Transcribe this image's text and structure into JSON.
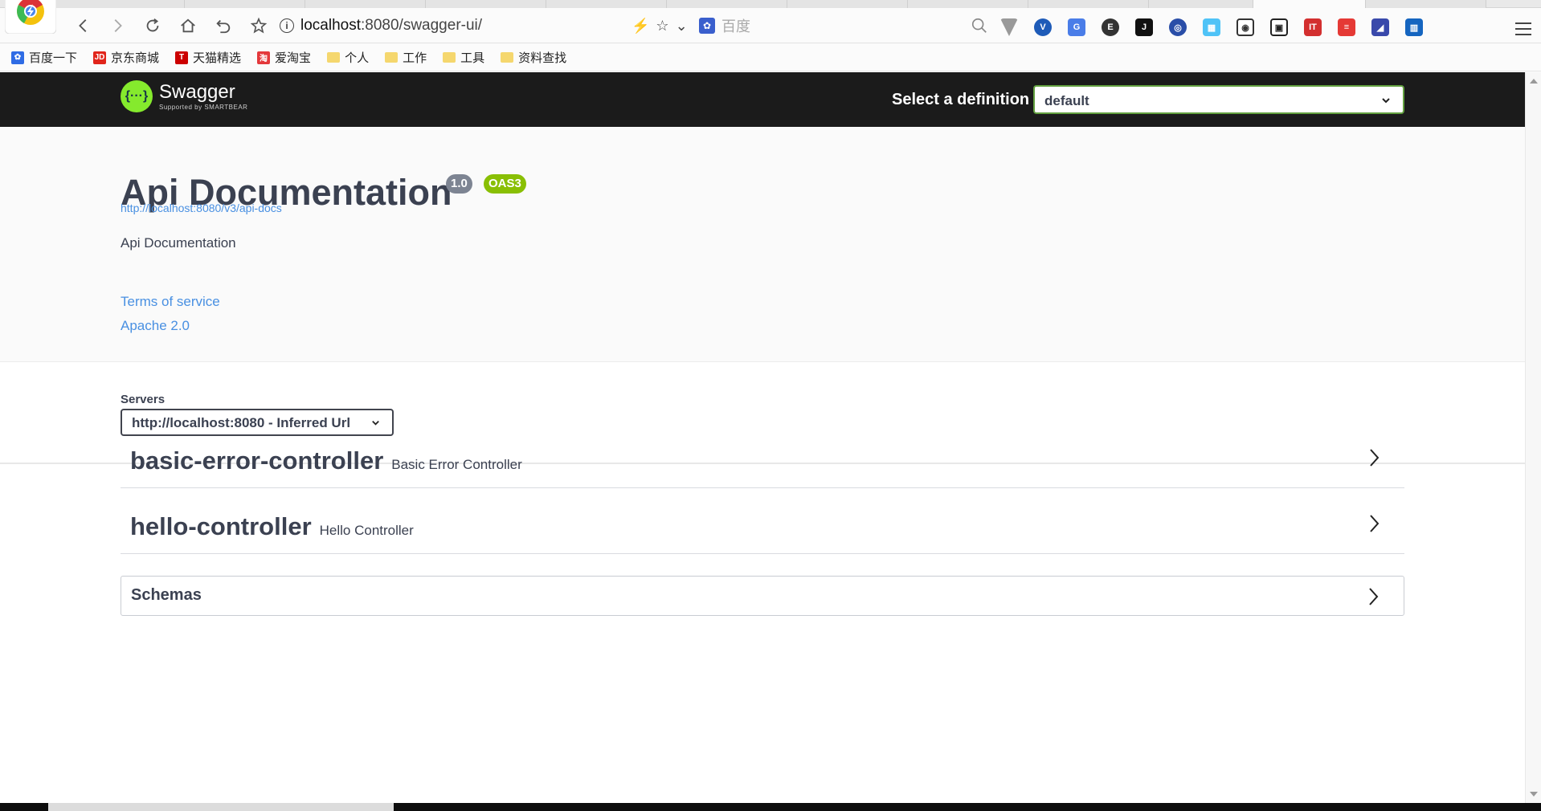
{
  "browser": {
    "url_host": "localhost",
    "url_rest": ":8080/swagger-ui/",
    "search_placeholder": "百度",
    "bookmarks": [
      {
        "label": "百度一下",
        "icon": "baidu-icon"
      },
      {
        "label": "京东商城",
        "icon": "jd-icon"
      },
      {
        "label": "天猫精选",
        "icon": "tmall-icon"
      },
      {
        "label": "爱淘宝",
        "icon": "taobao-icon"
      },
      {
        "label": "个人",
        "icon": "folder-icon"
      },
      {
        "label": "工作",
        "icon": "folder-icon"
      },
      {
        "label": "工具",
        "icon": "folder-icon"
      },
      {
        "label": "资料查找",
        "icon": "folder-icon"
      }
    ],
    "colors": {
      "accent_green": "#85ea2d",
      "link_blue": "#4990e2",
      "oas_badge": "#89bf04",
      "version_badge": "#7d8492"
    }
  },
  "topbar": {
    "logo_name": "Swagger",
    "logo_sub": "Supported by SMARTBEAR",
    "definition_label": "Select a definition",
    "definition_value": "default"
  },
  "info": {
    "title": "Api Documentation",
    "version": "1.0",
    "oas": "OAS3",
    "spec_url": "http://localhost:8080/v3/api-docs",
    "description": "Api Documentation",
    "terms": "Terms of service",
    "license": "Apache 2.0"
  },
  "servers": {
    "label": "Servers",
    "selected": "http://localhost:8080 - Inferred Url"
  },
  "tags": [
    {
      "name": "basic-error-controller",
      "description": "Basic Error Controller"
    },
    {
      "name": "hello-controller",
      "description": "Hello Controller"
    }
  ],
  "schemas": {
    "title": "Schemas"
  }
}
